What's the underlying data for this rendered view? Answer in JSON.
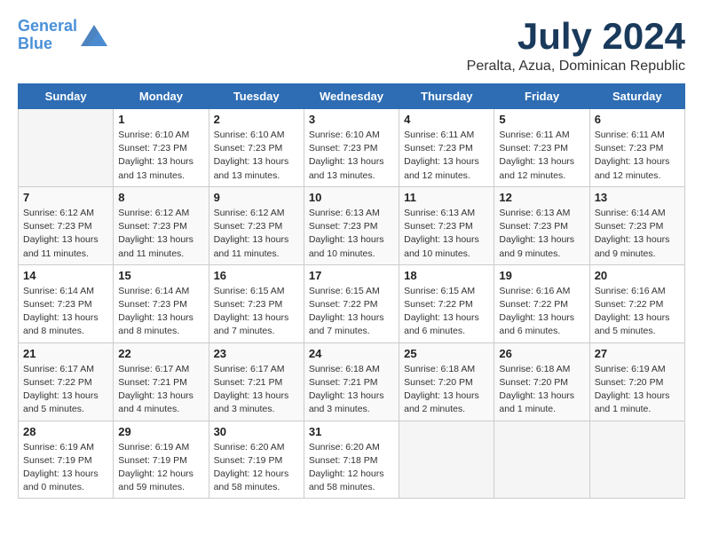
{
  "header": {
    "logo_line1": "General",
    "logo_line2": "Blue",
    "month": "July 2024",
    "location": "Peralta, Azua, Dominican Republic"
  },
  "weekdays": [
    "Sunday",
    "Monday",
    "Tuesday",
    "Wednesday",
    "Thursday",
    "Friday",
    "Saturday"
  ],
  "weeks": [
    [
      {
        "day": "",
        "info": ""
      },
      {
        "day": "1",
        "info": "Sunrise: 6:10 AM\nSunset: 7:23 PM\nDaylight: 13 hours\nand 13 minutes."
      },
      {
        "day": "2",
        "info": "Sunrise: 6:10 AM\nSunset: 7:23 PM\nDaylight: 13 hours\nand 13 minutes."
      },
      {
        "day": "3",
        "info": "Sunrise: 6:10 AM\nSunset: 7:23 PM\nDaylight: 13 hours\nand 13 minutes."
      },
      {
        "day": "4",
        "info": "Sunrise: 6:11 AM\nSunset: 7:23 PM\nDaylight: 13 hours\nand 12 minutes."
      },
      {
        "day": "5",
        "info": "Sunrise: 6:11 AM\nSunset: 7:23 PM\nDaylight: 13 hours\nand 12 minutes."
      },
      {
        "day": "6",
        "info": "Sunrise: 6:11 AM\nSunset: 7:23 PM\nDaylight: 13 hours\nand 12 minutes."
      }
    ],
    [
      {
        "day": "7",
        "info": "Sunrise: 6:12 AM\nSunset: 7:23 PM\nDaylight: 13 hours\nand 11 minutes."
      },
      {
        "day": "8",
        "info": "Sunrise: 6:12 AM\nSunset: 7:23 PM\nDaylight: 13 hours\nand 11 minutes."
      },
      {
        "day": "9",
        "info": "Sunrise: 6:12 AM\nSunset: 7:23 PM\nDaylight: 13 hours\nand 11 minutes."
      },
      {
        "day": "10",
        "info": "Sunrise: 6:13 AM\nSunset: 7:23 PM\nDaylight: 13 hours\nand 10 minutes."
      },
      {
        "day": "11",
        "info": "Sunrise: 6:13 AM\nSunset: 7:23 PM\nDaylight: 13 hours\nand 10 minutes."
      },
      {
        "day": "12",
        "info": "Sunrise: 6:13 AM\nSunset: 7:23 PM\nDaylight: 13 hours\nand 9 minutes."
      },
      {
        "day": "13",
        "info": "Sunrise: 6:14 AM\nSunset: 7:23 PM\nDaylight: 13 hours\nand 9 minutes."
      }
    ],
    [
      {
        "day": "14",
        "info": "Sunrise: 6:14 AM\nSunset: 7:23 PM\nDaylight: 13 hours\nand 8 minutes."
      },
      {
        "day": "15",
        "info": "Sunrise: 6:14 AM\nSunset: 7:23 PM\nDaylight: 13 hours\nand 8 minutes."
      },
      {
        "day": "16",
        "info": "Sunrise: 6:15 AM\nSunset: 7:23 PM\nDaylight: 13 hours\nand 7 minutes."
      },
      {
        "day": "17",
        "info": "Sunrise: 6:15 AM\nSunset: 7:22 PM\nDaylight: 13 hours\nand 7 minutes."
      },
      {
        "day": "18",
        "info": "Sunrise: 6:15 AM\nSunset: 7:22 PM\nDaylight: 13 hours\nand 6 minutes."
      },
      {
        "day": "19",
        "info": "Sunrise: 6:16 AM\nSunset: 7:22 PM\nDaylight: 13 hours\nand 6 minutes."
      },
      {
        "day": "20",
        "info": "Sunrise: 6:16 AM\nSunset: 7:22 PM\nDaylight: 13 hours\nand 5 minutes."
      }
    ],
    [
      {
        "day": "21",
        "info": "Sunrise: 6:17 AM\nSunset: 7:22 PM\nDaylight: 13 hours\nand 5 minutes."
      },
      {
        "day": "22",
        "info": "Sunrise: 6:17 AM\nSunset: 7:21 PM\nDaylight: 13 hours\nand 4 minutes."
      },
      {
        "day": "23",
        "info": "Sunrise: 6:17 AM\nSunset: 7:21 PM\nDaylight: 13 hours\nand 3 minutes."
      },
      {
        "day": "24",
        "info": "Sunrise: 6:18 AM\nSunset: 7:21 PM\nDaylight: 13 hours\nand 3 minutes."
      },
      {
        "day": "25",
        "info": "Sunrise: 6:18 AM\nSunset: 7:20 PM\nDaylight: 13 hours\nand 2 minutes."
      },
      {
        "day": "26",
        "info": "Sunrise: 6:18 AM\nSunset: 7:20 PM\nDaylight: 13 hours\nand 1 minute."
      },
      {
        "day": "27",
        "info": "Sunrise: 6:19 AM\nSunset: 7:20 PM\nDaylight: 13 hours\nand 1 minute."
      }
    ],
    [
      {
        "day": "28",
        "info": "Sunrise: 6:19 AM\nSunset: 7:19 PM\nDaylight: 13 hours\nand 0 minutes."
      },
      {
        "day": "29",
        "info": "Sunrise: 6:19 AM\nSunset: 7:19 PM\nDaylight: 12 hours\nand 59 minutes."
      },
      {
        "day": "30",
        "info": "Sunrise: 6:20 AM\nSunset: 7:19 PM\nDaylight: 12 hours\nand 58 minutes."
      },
      {
        "day": "31",
        "info": "Sunrise: 6:20 AM\nSunset: 7:18 PM\nDaylight: 12 hours\nand 58 minutes."
      },
      {
        "day": "",
        "info": ""
      },
      {
        "day": "",
        "info": ""
      },
      {
        "day": "",
        "info": ""
      }
    ]
  ]
}
